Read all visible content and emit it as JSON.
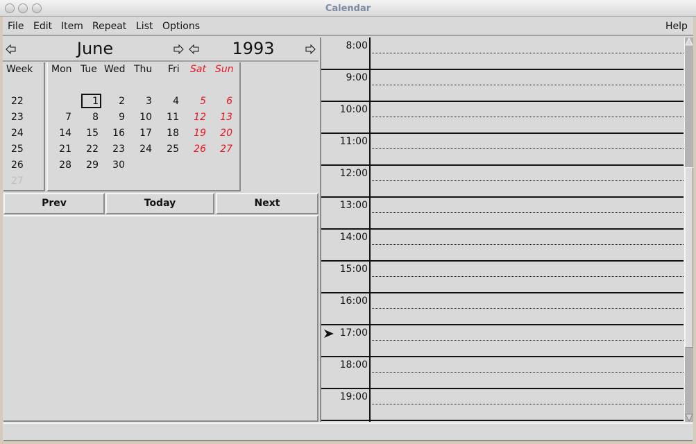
{
  "window": {
    "title": "Calendar"
  },
  "menubar": {
    "items": [
      {
        "label": "File"
      },
      {
        "label": "Edit"
      },
      {
        "label": "Item"
      },
      {
        "label": "Repeat"
      },
      {
        "label": "List"
      },
      {
        "label": "Options"
      }
    ],
    "help_label": "Help"
  },
  "navigator": {
    "month": "June",
    "year": "1993",
    "prev_month_icon": "arrow-left-icon",
    "next_month_icon": "arrow-right-icon",
    "prev_year_icon": "arrow-left-icon",
    "next_year_icon": "arrow-right-icon"
  },
  "month_grid": {
    "week_header": "Week",
    "day_headers": [
      "Mon",
      "Tue",
      "Wed",
      "Thu",
      "Fri",
      "Sat",
      "Sun"
    ],
    "weekend_color": "#e8141e",
    "weeks": [
      {
        "week": "22",
        "days": [
          "",
          "1",
          "2",
          "3",
          "4",
          "5",
          "6"
        ]
      },
      {
        "week": "23",
        "days": [
          "7",
          "8",
          "9",
          "10",
          "11",
          "12",
          "13"
        ]
      },
      {
        "week": "24",
        "days": [
          "14",
          "15",
          "16",
          "17",
          "18",
          "19",
          "20"
        ]
      },
      {
        "week": "25",
        "days": [
          "21",
          "22",
          "23",
          "24",
          "25",
          "26",
          "27"
        ]
      },
      {
        "week": "26",
        "days": [
          "28",
          "29",
          "30",
          "",
          "",
          "",
          ""
        ]
      },
      {
        "week": "27",
        "days": [
          "",
          "",
          "",
          "",
          "",
          "",
          ""
        ],
        "dimmed": true
      }
    ],
    "selected_day": "1"
  },
  "buttons": {
    "prev": "Prev",
    "today": "Today",
    "next": "Next"
  },
  "schedule": {
    "hours": [
      "8:00",
      "9:00",
      "10:00",
      "11:00",
      "12:00",
      "13:00",
      "14:00",
      "15:00",
      "16:00",
      "17:00",
      "18:00",
      "19:00"
    ],
    "current_hour": "17:00",
    "current_indicator_icon": "pointer-arrow-icon",
    "scroll": {
      "thumb_start_fraction": 0.33,
      "thumb_end_fraction": 0.82
    }
  },
  "status": {
    "text": ""
  }
}
